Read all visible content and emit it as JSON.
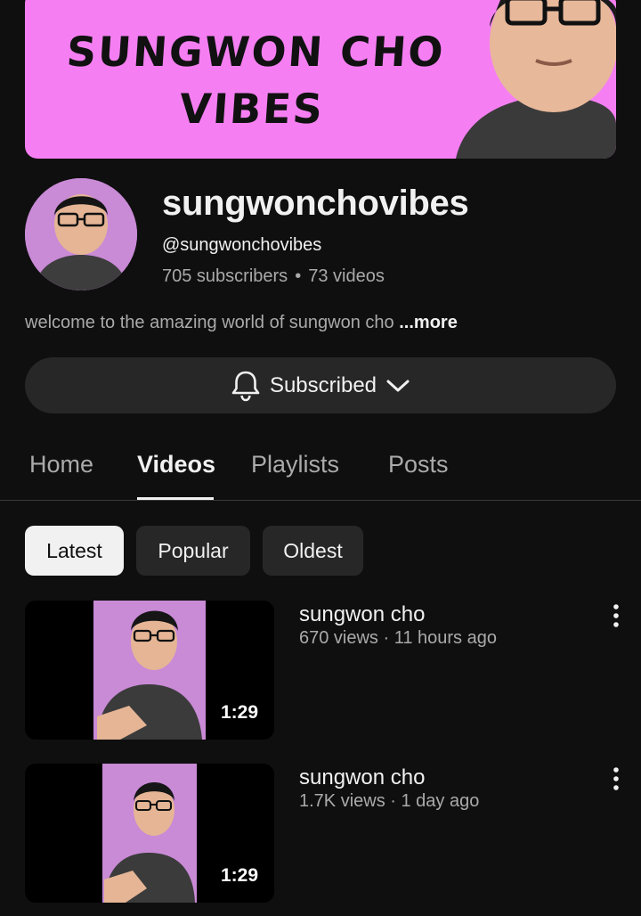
{
  "banner": {
    "text_line1": "SUNGWON CHO",
    "text_line2": "VIBES",
    "bg_color": "#f57ff2"
  },
  "channel": {
    "name": "sungwonchovibes",
    "handle": "@sungwonchovibes",
    "subscribers": "705 subscribers",
    "videos": "73 videos",
    "separator": "•",
    "description": "welcome to the amazing world of sungwon cho ",
    "more_label": "...more"
  },
  "subscribe": {
    "label": "Subscribed",
    "bell_icon": "bell-icon",
    "chevron_icon": "chevron-down-icon"
  },
  "tabs": [
    {
      "label": "Home",
      "active": false
    },
    {
      "label": "Videos",
      "active": true
    },
    {
      "label": "Playlists",
      "active": false
    },
    {
      "label": "Posts",
      "active": false
    }
  ],
  "chips": [
    {
      "label": "Latest",
      "selected": true
    },
    {
      "label": "Popular",
      "selected": false
    },
    {
      "label": "Oldest",
      "selected": false
    }
  ],
  "videos": [
    {
      "title": "sungwon cho",
      "meta": "670 views · 11 hours ago",
      "duration": "1:29"
    },
    {
      "title": "sungwon cho",
      "meta": "1.7K views · 1 day ago",
      "duration": "1:29"
    }
  ],
  "colors": {
    "background": "#0f0f0f",
    "surface": "#272727",
    "text_primary": "#f1f1f1",
    "text_secondary": "#aaaaaa",
    "thumb_bg": "#c98ad6"
  }
}
